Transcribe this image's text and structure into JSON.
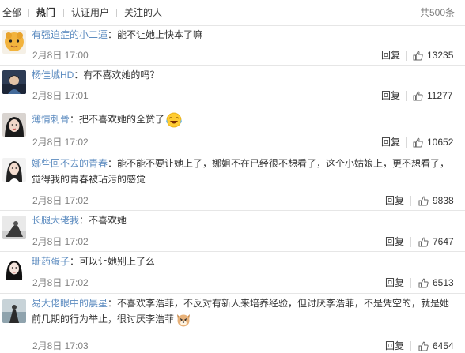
{
  "tabs": [
    {
      "label": "全部",
      "active": false
    },
    {
      "label": "热门",
      "active": true
    },
    {
      "label": "认证用户",
      "active": false
    },
    {
      "label": "关注的人",
      "active": false
    }
  ],
  "total": "共500条",
  "reply_label": "回复",
  "comments": [
    {
      "user": "有强迫症的小二逼",
      "colon": "：",
      "text": "能不让她上快本了嘛",
      "time": "2月8日 17:00",
      "likes": "13235",
      "emoji": ""
    },
    {
      "user": "杨佳城HD",
      "colon": "：",
      "text": "有不喜欢她的吗？",
      "time": "2月8日 17:01",
      "likes": "11277",
      "emoji": ""
    },
    {
      "user": "薄情刺骨",
      "colon": "：",
      "text": "把不喜欢她的全赞了",
      "time": "2月8日 17:02",
      "likes": "10652",
      "emoji": "laugh-cry-emoji"
    },
    {
      "user": "娜些回不去的青春",
      "colon": "：",
      "text": "能不能不要让她上了，娜姐不在已经很不想看了，这个小姑娘上，更不想看了，觉得我的青春被玷污的感觉",
      "time": "2月8日 17:02",
      "likes": "9838",
      "emoji": ""
    },
    {
      "user": "长腿大佬我",
      "colon": "：",
      "text": "不喜欢她",
      "time": "2月8日 17:02",
      "likes": "7647",
      "emoji": ""
    },
    {
      "user": "珊药蛋子",
      "colon": "：",
      "text": "可以让她别上了么",
      "time": "2月8日 17:02",
      "likes": "6513",
      "emoji": ""
    },
    {
      "user": "易大佬眼中的晨星",
      "colon": "：",
      "text": "不喜欢李浩菲，不反对有新人来培养经验，但讨厌李浩菲，不是凭空的，就是她前几期的行为举止，很讨厌李浩菲",
      "time": "2月8日 17:03",
      "likes": "6454",
      "emoji": "angry-dog-emoji"
    }
  ],
  "colors": {
    "link": "#5d8cc0",
    "text": "#333333",
    "muted": "#808080",
    "border": "#e6e6e6"
  }
}
